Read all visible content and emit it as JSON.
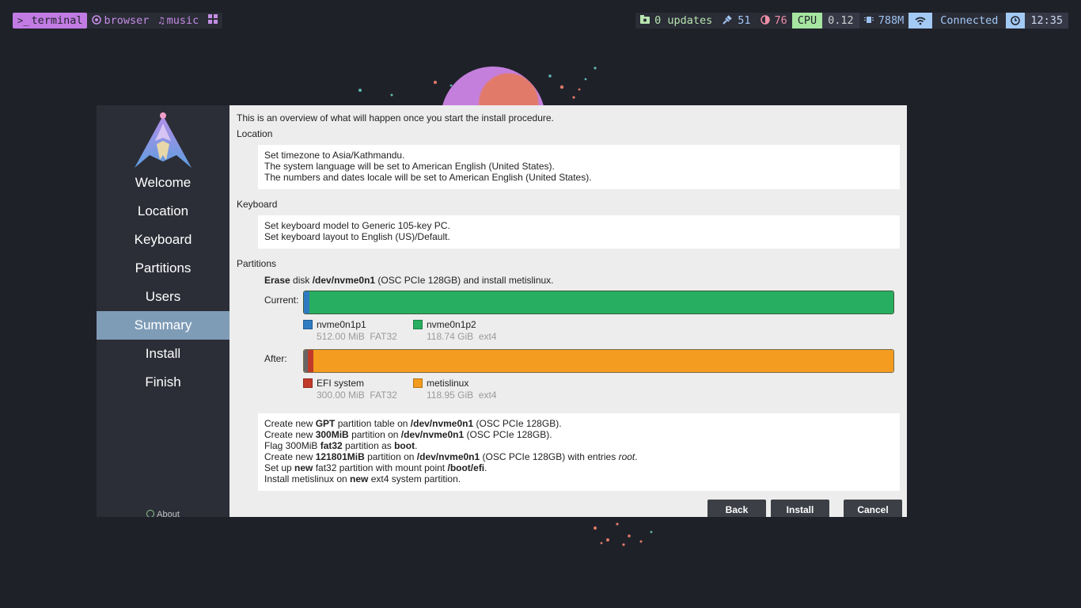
{
  "topbar": {
    "workspaces": [
      {
        "icon": "terminal-icon",
        "label": "terminal",
        "active": true
      },
      {
        "icon": "chrome-icon",
        "label": "browser",
        "active": false
      },
      {
        "icon": "music-note-icon",
        "label": "music",
        "active": false
      },
      {
        "icon": "grid-icon",
        "label": "",
        "active": false
      }
    ],
    "updates": "0 updates",
    "brightness": "51",
    "contrast": "76",
    "cpu_label": "CPU",
    "cpu_value": "0.12",
    "memory": "788M",
    "network": "Connected",
    "clock": "12:35"
  },
  "sidebar": {
    "steps": [
      "Welcome",
      "Location",
      "Keyboard",
      "Partitions",
      "Users",
      "Summary",
      "Install",
      "Finish"
    ],
    "active_step": "Summary",
    "about": "About"
  },
  "summary": {
    "intro": "This is an overview of what will happen once you start the install procedure.",
    "location": {
      "title": "Location",
      "lines": [
        "Set timezone to Asia/Kathmandu.",
        "The system language will be set to American English (United States).",
        "The numbers and dates locale will be set to American English (United States)."
      ]
    },
    "keyboard": {
      "title": "Keyboard",
      "lines": [
        "Set keyboard model to Generic 105-key PC.",
        "Set keyboard layout to English (US)/Default."
      ]
    },
    "partitions": {
      "title": "Partitions",
      "erase_word": "Erase",
      "erase_mid": " disk ",
      "erase_disk": "/dev/nvme0n1",
      "erase_rest": " (OSC PCIe 128GB) and install metislinux.",
      "current_label": "Current:",
      "after_label": "After:",
      "current": [
        {
          "name": "nvme0n1p1",
          "size": "512.00 MiB",
          "fs": "FAT32",
          "color": "#2f7bc2",
          "fraction": 0.004
        },
        {
          "name": "nvme0n1p2",
          "size": "118.74 GiB",
          "fs": "ext4",
          "color": "#27ae60",
          "fraction": 0.996
        }
      ],
      "after": [
        {
          "name": "EFI system",
          "size": "300.00 MiB",
          "fs": "FAT32",
          "color": "#c0392b",
          "fraction": 0.0025
        },
        {
          "name": "metislinux",
          "size": "118.95 GiB",
          "fs": "ext4",
          "color": "#f39c1f",
          "fraction": 0.9975
        }
      ]
    },
    "actions": [
      [
        "Create new ",
        {
          "b": "GPT"
        },
        " partition table on ",
        {
          "b": "/dev/nvme0n1"
        },
        " (OSC PCIe 128GB)."
      ],
      [
        "Create new ",
        {
          "b": "300MiB"
        },
        " partition on ",
        {
          "b": "/dev/nvme0n1"
        },
        " (OSC PCIe 128GB)."
      ],
      [
        "Flag 300MiB ",
        {
          "b": "fat32"
        },
        " partition as ",
        {
          "b": "boot"
        },
        "."
      ],
      [
        "Create new ",
        {
          "b": "121801MiB"
        },
        " partition on ",
        {
          "b": "/dev/nvme0n1"
        },
        " (OSC PCIe 128GB) with entries ",
        {
          "i": "root"
        },
        "."
      ],
      [
        "Set up ",
        {
          "b": "new"
        },
        " fat32 partition with mount point ",
        {
          "b": "/boot/efi"
        },
        "."
      ],
      [
        "Install metislinux on ",
        {
          "b": "new"
        },
        " ext4 system partition."
      ]
    ]
  },
  "buttons": {
    "back": "Back",
    "install": "Install",
    "cancel": "Cancel"
  }
}
